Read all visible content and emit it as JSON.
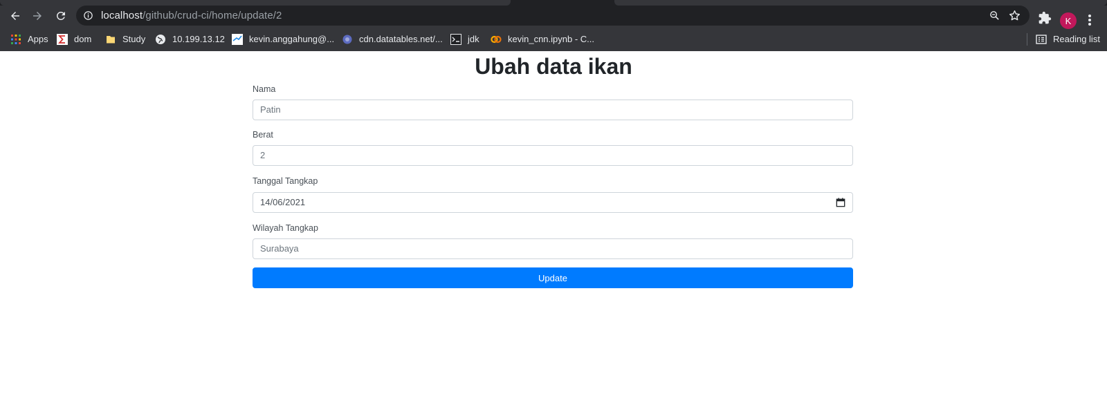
{
  "browser": {
    "url_host": "localhost",
    "url_path": "/github/crud-ci/home/update/2",
    "profile_initial": "K",
    "reading_list_label": "Reading list"
  },
  "bookmarks": [
    {
      "label": "Apps",
      "icon": "apps-grid-icon"
    },
    {
      "label": "dom",
      "icon": "sigma-icon"
    },
    {
      "label": "Study",
      "icon": "folder-icon"
    },
    {
      "label": "10.199.13.12",
      "icon": "globe-icon"
    },
    {
      "label": "kevin.anggahung@...",
      "icon": "mail-icon"
    },
    {
      "label": "cdn.datatables.net/...",
      "icon": "datatables-icon"
    },
    {
      "label": "jdk",
      "icon": "terminal-icon"
    },
    {
      "label": "kevin_cnn.ipynb - C...",
      "icon": "colab-icon"
    }
  ],
  "page": {
    "title": "Ubah data ikan",
    "fields": {
      "nama": {
        "label": "Nama",
        "value": "Patin"
      },
      "berat": {
        "label": "Berat",
        "value": "2"
      },
      "tanggal": {
        "label": "Tanggal Tangkap",
        "value": "14/06/2021"
      },
      "wilayah": {
        "label": "Wilayah Tangkap",
        "value": "Surabaya"
      }
    },
    "submit_label": "Update"
  },
  "colors": {
    "accent": "#007bff",
    "chrome_bg": "#35363a",
    "omnibox_bg": "#202124",
    "avatar": "#c2185b"
  }
}
